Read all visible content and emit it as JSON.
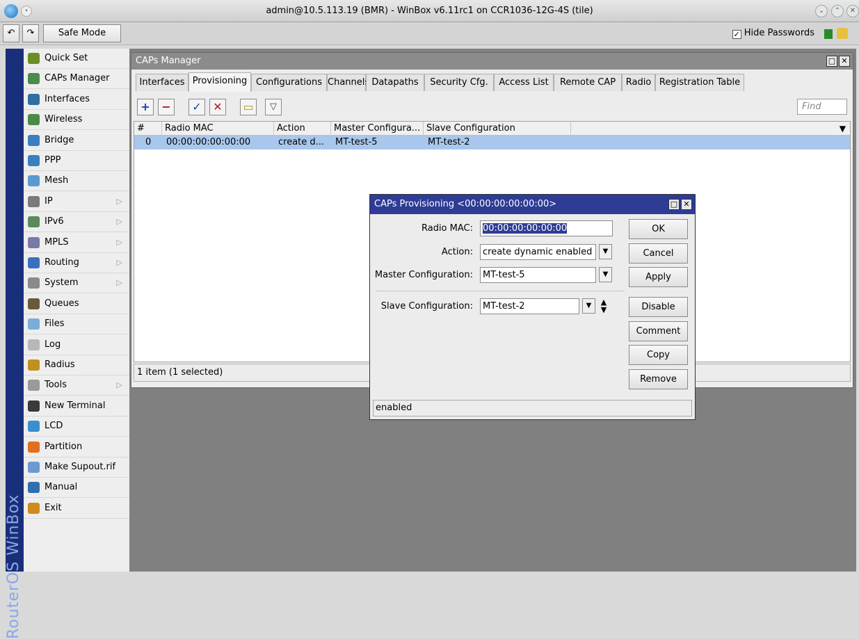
{
  "window": {
    "title": "admin@10.5.113.19 (BMR) - WinBox v6.11rc1 on CCR1036-12G-4S (tile)"
  },
  "toolbar": {
    "safe_mode": "Safe Mode",
    "hide_passwords": "Hide Passwords",
    "hide_passwords_checked": true
  },
  "sidebar": {
    "brand": "RouterOS WinBox",
    "items": [
      {
        "label": "Quick Set",
        "icon": "quick-set-icon"
      },
      {
        "label": "CAPs Manager",
        "icon": "antenna-icon"
      },
      {
        "label": "Interfaces",
        "icon": "interfaces-icon"
      },
      {
        "label": "Wireless",
        "icon": "antenna-icon"
      },
      {
        "label": "Bridge",
        "icon": "bridge-icon"
      },
      {
        "label": "PPP",
        "icon": "ppp-icon"
      },
      {
        "label": "Mesh",
        "icon": "mesh-icon"
      },
      {
        "label": "IP",
        "icon": "ip-icon",
        "submenu": true
      },
      {
        "label": "IPv6",
        "icon": "ipv6-icon",
        "submenu": true
      },
      {
        "label": "MPLS",
        "icon": "mpls-icon",
        "submenu": true
      },
      {
        "label": "Routing",
        "icon": "routing-icon",
        "submenu": true
      },
      {
        "label": "System",
        "icon": "gear-icon",
        "submenu": true
      },
      {
        "label": "Queues",
        "icon": "queues-icon"
      },
      {
        "label": "Files",
        "icon": "folder-icon"
      },
      {
        "label": "Log",
        "icon": "log-icon"
      },
      {
        "label": "Radius",
        "icon": "radius-icon"
      },
      {
        "label": "Tools",
        "icon": "tools-icon",
        "submenu": true
      },
      {
        "label": "New Terminal",
        "icon": "terminal-icon"
      },
      {
        "label": "LCD",
        "icon": "lcd-icon"
      },
      {
        "label": "Partition",
        "icon": "partition-icon"
      },
      {
        "label": "Make Supout.rif",
        "icon": "file-icon"
      },
      {
        "label": "Manual",
        "icon": "help-icon"
      },
      {
        "label": "Exit",
        "icon": "exit-icon"
      }
    ]
  },
  "caps": {
    "title": "CAPs Manager",
    "tabs": [
      "Interfaces",
      "Provisioning",
      "Configurations",
      "Channels",
      "Datapaths",
      "Security Cfg.",
      "Access List",
      "Remote CAP",
      "Radio",
      "Registration Table"
    ],
    "active_tab": "Provisioning",
    "find_placeholder": "Find",
    "columns": [
      "#",
      "Radio MAC",
      "Action",
      "Master Configura...",
      "Slave Configuration"
    ],
    "rows": [
      {
        "num": "0",
        "mac": "00:00:00:00:00:00",
        "action": "create d...",
        "master": "MT-test-5",
        "slave": "MT-test-2"
      }
    ],
    "status": "1 item (1 selected)"
  },
  "dialog": {
    "title": "CAPs Provisioning <00:00:00:00:00:00>",
    "radio_mac_label": "Radio MAC:",
    "radio_mac": "00:00:00:00:00:00",
    "action_label": "Action:",
    "action": "create dynamic enabled",
    "master_label": "Master Configuration:",
    "master": "MT-test-5",
    "slave_label": "Slave Configuration:",
    "slave": "MT-test-2",
    "buttons": {
      "ok": "OK",
      "cancel": "Cancel",
      "apply": "Apply",
      "disable": "Disable",
      "comment": "Comment",
      "copy": "Copy",
      "remove": "Remove"
    },
    "status": "enabled"
  },
  "colors": {
    "brand_bar": "#1a2f7a",
    "dialog_title": "#2e3c96",
    "selected_row": "#a9c7ec",
    "desktop": "#808080"
  }
}
